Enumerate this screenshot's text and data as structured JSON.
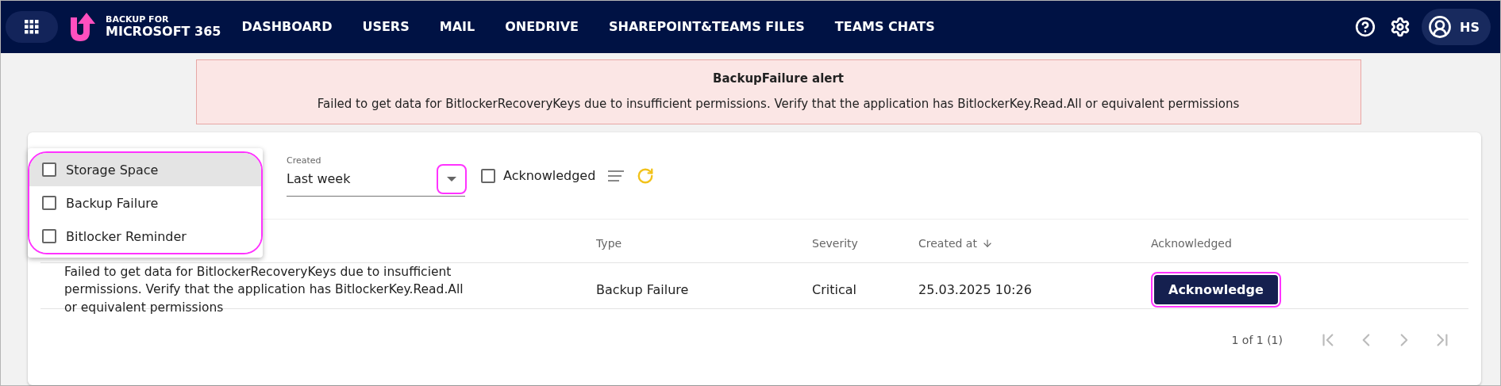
{
  "header": {
    "logo_lines": [
      "BACKUP FOR",
      "MICROSOFT 365"
    ],
    "nav": [
      {
        "label": "DASHBOARD",
        "selected": false
      },
      {
        "label": "USERS",
        "selected": false
      },
      {
        "label": "MAIL",
        "selected": false
      },
      {
        "label": "ONEDRIVE",
        "selected": false
      },
      {
        "label": "SHAREPOINT&TEAMS FILES",
        "selected": false
      },
      {
        "label": "TEAMS CHATS",
        "selected": false
      }
    ],
    "user_initials": "HS"
  },
  "alert": {
    "title": "BackupFailure alert",
    "message": "Failed to get data for BitlockerRecoveryKeys due to insufficient permissions. Verify that the application has BitlockerKey.Read.All or equivalent permissions"
  },
  "filters": {
    "type_menu": {
      "highlighted": true,
      "options": [
        {
          "label": "Storage Space",
          "checked": false,
          "hovered": true
        },
        {
          "label": "Backup Failure",
          "checked": false,
          "hovered": false
        },
        {
          "label": "Bitlocker Reminder",
          "checked": false,
          "hovered": false
        }
      ]
    },
    "created": {
      "label": "Created",
      "value": "Last week",
      "arrow_highlighted": true
    },
    "acknowledged": {
      "label": "Acknowledged",
      "checked": false
    }
  },
  "table": {
    "columns": [
      "Type",
      "Severity",
      "Created at",
      "Acknowledged"
    ],
    "rows": [
      {
        "message": "Failed to get data for BitlockerRecoveryKeys due to insufficient permissions. Verify that the application has BitlockerKey.Read.All or equivalent permissions",
        "type": "Backup Failure",
        "severity": "Critical",
        "created_at": "25.03.2025 10:26",
        "action": "Acknowledge",
        "action_highlighted": true
      }
    ]
  },
  "pagination": {
    "summary": "1 of 1 (1)"
  }
}
